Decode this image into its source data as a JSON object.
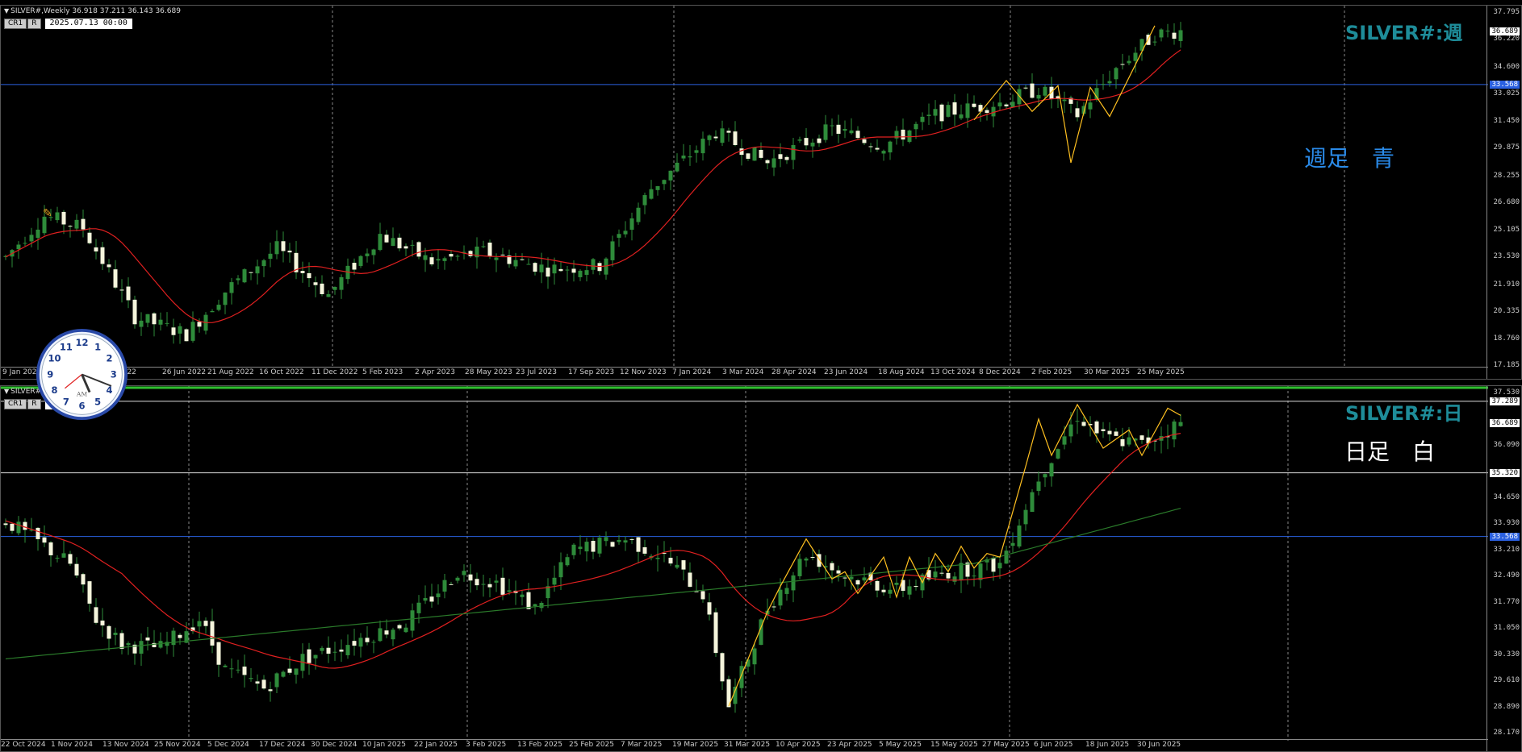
{
  "colors": {
    "bull": "#2e8b3a",
    "bear": "#f5f5dc",
    "ma": "#e02020",
    "ma_long": "#2a7a2a",
    "zigzag": "#ffc020",
    "blue_line": "#2a60e0",
    "white_line": "#dddddd",
    "grid": "#888888"
  },
  "top": {
    "header": "SILVER#,Weekly  36.918 37.211 36.143 36.689",
    "btn_cr": "CR1",
    "btn_r": "R",
    "time_box": "2025.07.13 00:00",
    "symbol_label": "SILVER#:週",
    "note": "週足　青",
    "price_ticks": [
      "37.795",
      "36.689",
      "36.220",
      "34.600",
      "33.568",
      "33.025",
      "31.450",
      "29.875",
      "28.255",
      "26.680",
      "25.105",
      "23.530",
      "21.910",
      "20.335",
      "18.760",
      "17.185"
    ],
    "current_price": "36.689",
    "line_price": "33.568",
    "dates": [
      "9 Jan 2022",
      "2022",
      "26 Jun 2022",
      "21 Aug 2022",
      "16 Oct 2022",
      "11 Dec 2022",
      "5 Feb 2023",
      "2 Apr 2023",
      "28 May 2023",
      "23 Jul 2023",
      "17 Sep 2023",
      "12 Nov 2023",
      "7 Jan 2024",
      "3 Mar 2024",
      "28 Apr 2024",
      "23 Jun 2024",
      "18 Aug 2024",
      "13 Oct 2024",
      "8 Dec 2024",
      "2 Feb 2025",
      "30 Mar 2025",
      "25 May 2025"
    ]
  },
  "bottom": {
    "header": "SILVER#  ...279 36.689",
    "btn_cr": "CR1",
    "btn_r": "R",
    "time_box": "00",
    "symbol_label": "SILVER#:日",
    "note": "日足　白",
    "price_ticks": [
      "37.530",
      "37.289",
      "36.689",
      "36.090",
      "35.320",
      "34.650",
      "33.930",
      "33.568",
      "33.210",
      "32.490",
      "31.770",
      "31.050",
      "30.330",
      "29.610",
      "28.890",
      "28.170"
    ],
    "current_price": "36.689",
    "high_line": "37.289",
    "mid_line": "35.320",
    "blue_line": "33.568",
    "dates": [
      "22 Oct 2024",
      "1 Nov 2024",
      "13 Nov 2024",
      "25 Nov 2024",
      "5 Dec 2024",
      "17 Dec 2024",
      "30 Dec 2024",
      "10 Jan 2025",
      "22 Jan 2025",
      "3 Feb 2025",
      "13 Feb 2025",
      "25 Feb 2025",
      "7 Mar 2025",
      "19 Mar 2025",
      "31 Mar 2025",
      "10 Apr 2025",
      "23 Apr 2025",
      "5 May 2025",
      "15 May 2025",
      "27 May 2025",
      "6 Jun 2025",
      "18 Jun 2025",
      "30 Jun 2025"
    ]
  },
  "clock": {
    "am": "AM",
    "numbers": [
      "12",
      "1",
      "2",
      "3",
      "4",
      "5",
      "6",
      "7",
      "8",
      "9",
      "10",
      "11"
    ]
  }
}
